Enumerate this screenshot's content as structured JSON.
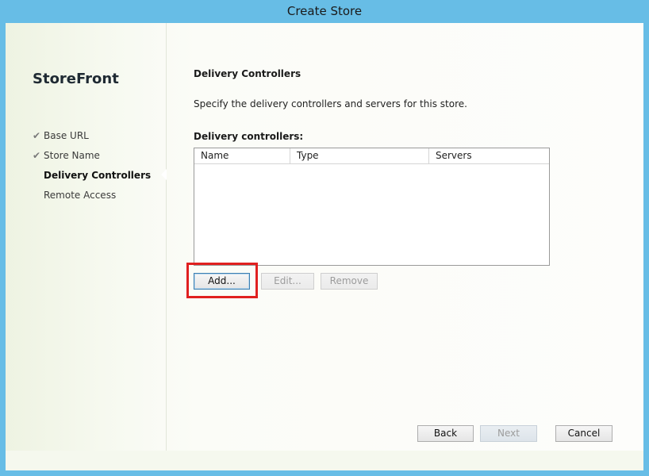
{
  "window": {
    "title": "Create Store"
  },
  "sidebar": {
    "brand": "StoreFront",
    "steps": [
      {
        "label": "Base URL",
        "completed": true,
        "active": false
      },
      {
        "label": "Store Name",
        "completed": true,
        "active": false
      },
      {
        "label": "Delivery Controllers",
        "completed": false,
        "active": true
      },
      {
        "label": "Remote Access",
        "completed": false,
        "active": false
      }
    ],
    "check_glyph": "✔"
  },
  "main": {
    "heading": "Delivery Controllers",
    "description": "Specify the delivery controllers and servers for this store.",
    "list_label": "Delivery controllers:",
    "table": {
      "columns": [
        "Name",
        "Type",
        "Servers"
      ],
      "rows": []
    },
    "buttons": {
      "add": "Add...",
      "edit": "Edit...",
      "remove": "Remove"
    }
  },
  "nav": {
    "back": "Back",
    "next": "Next",
    "cancel": "Cancel"
  },
  "colors": {
    "chrome": "#67bde6",
    "highlight": "#e02020"
  }
}
